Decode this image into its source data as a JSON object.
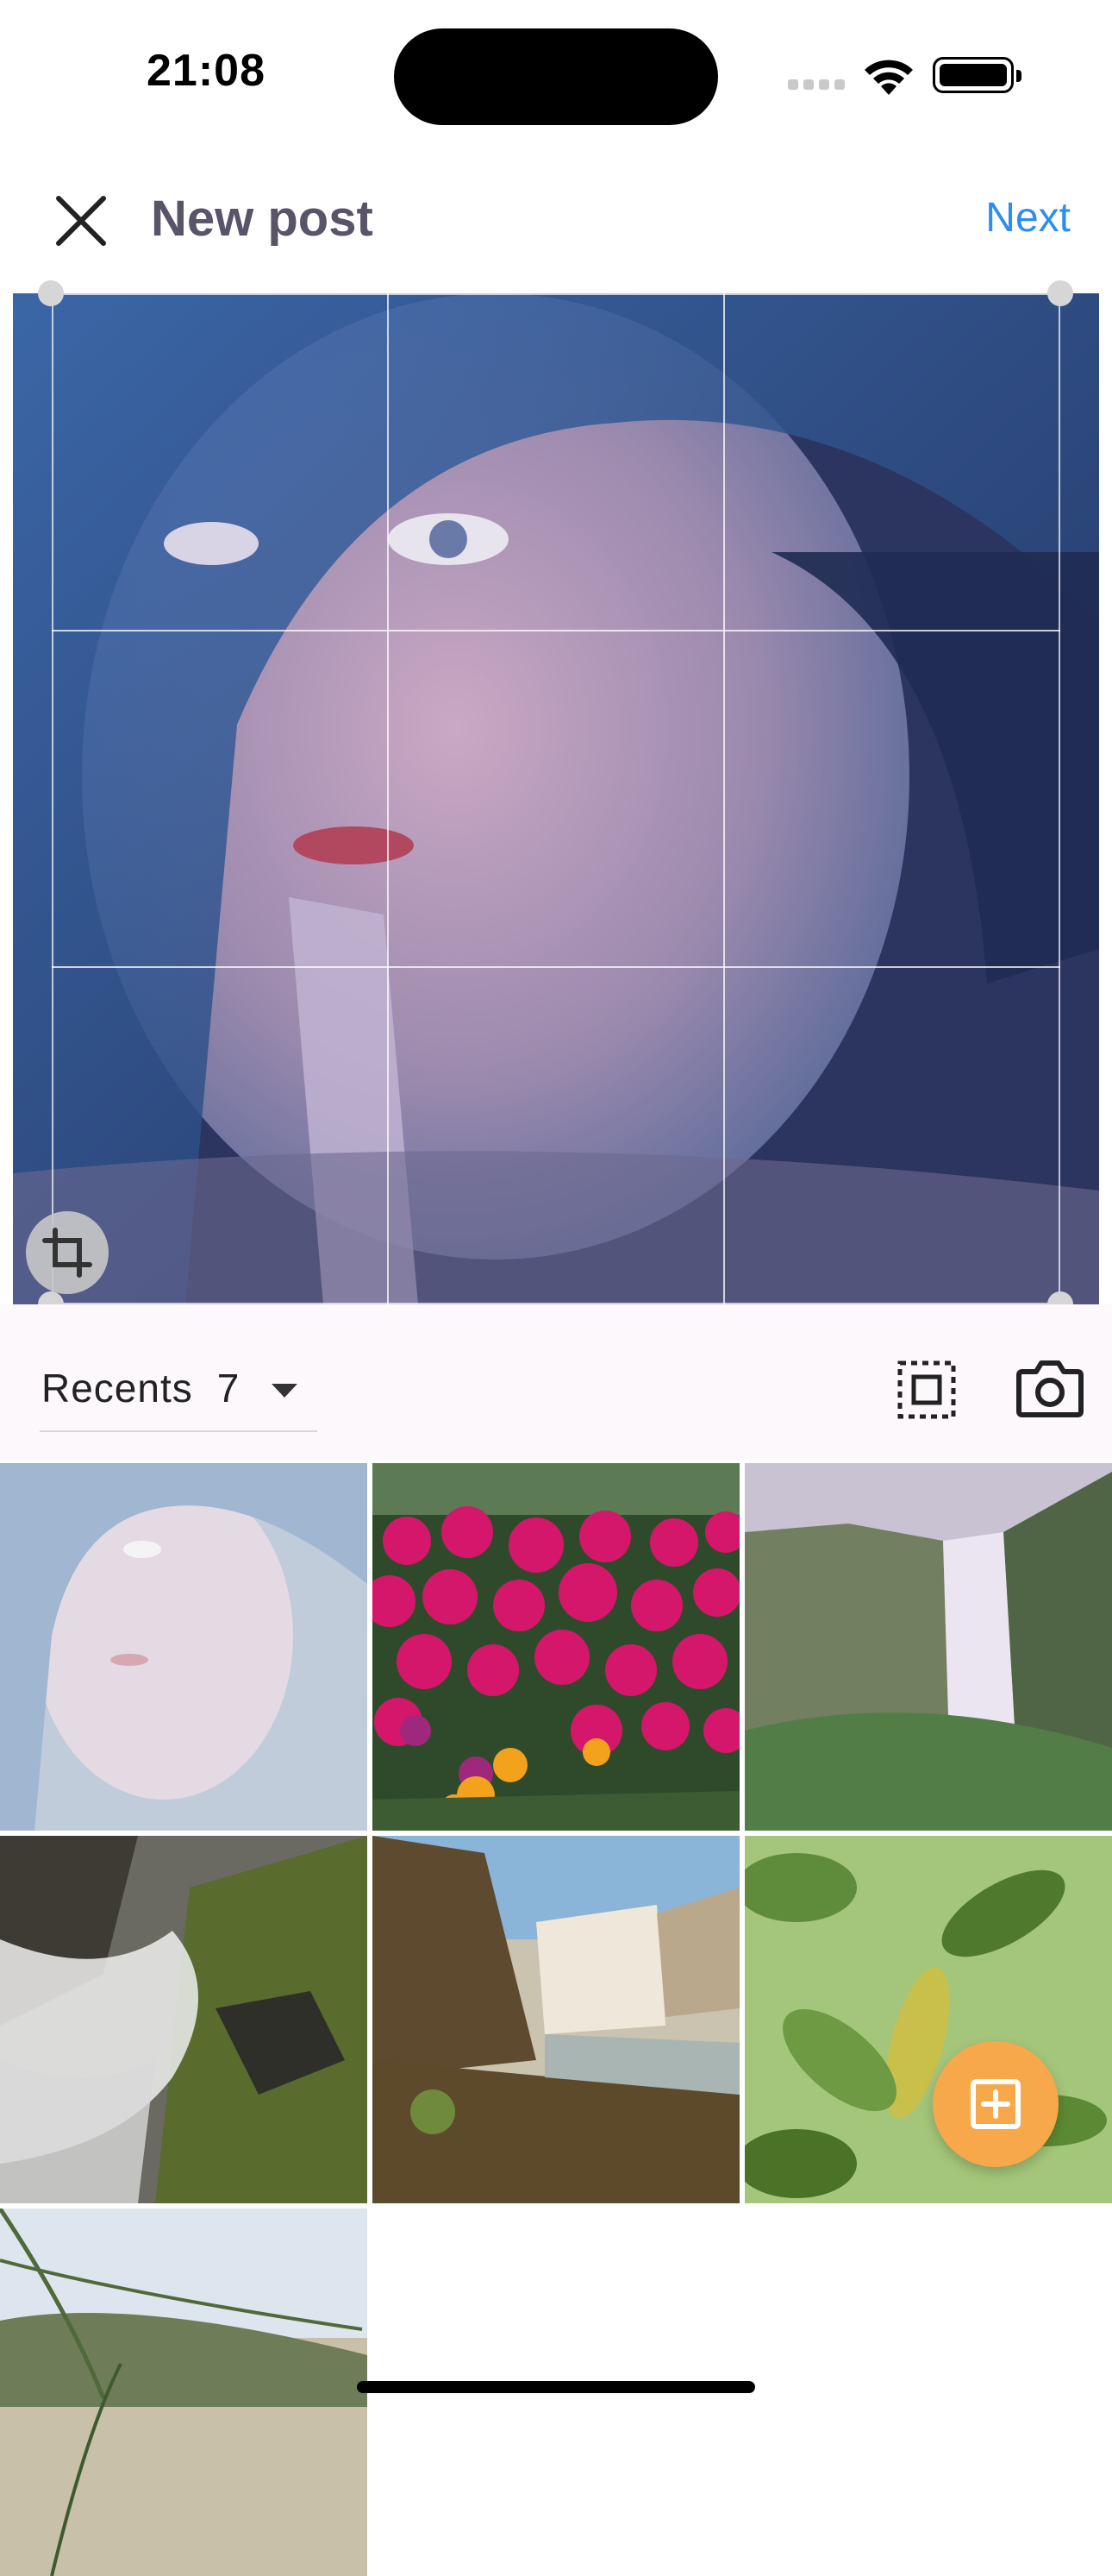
{
  "status": {
    "time": "21:08"
  },
  "header": {
    "title": "New post",
    "next_label": "Next"
  },
  "gallery_bar": {
    "album_label": "Recents",
    "album_count": "7"
  },
  "colors": {
    "accent": "#2c8ef0",
    "fab": "#f7a84a",
    "title": "#5a5468"
  },
  "gallery": {
    "tiles": [
      {
        "subject": "anime-girl-portrait",
        "selected": true
      },
      {
        "subject": "pink-flowers"
      },
      {
        "subject": "waterfall-cliffs"
      },
      {
        "subject": "mossy-waterfall"
      },
      {
        "subject": "waterfall-sunlight"
      },
      {
        "subject": "green-leaves"
      },
      {
        "subject": "dune-grass"
      }
    ]
  }
}
